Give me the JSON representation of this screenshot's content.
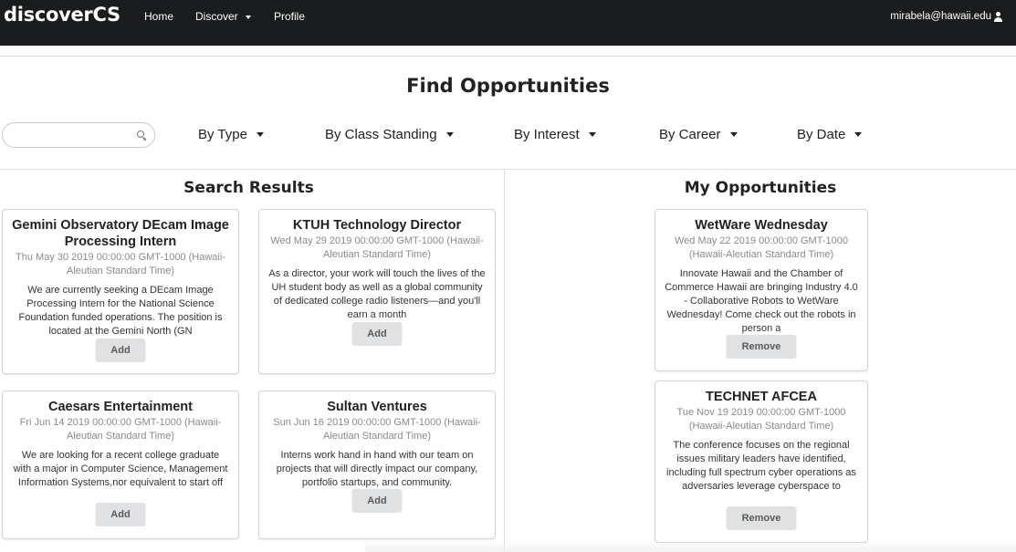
{
  "navbar": {
    "brand": "discoverCS",
    "home": "Home",
    "discover": "Discover",
    "profile": "Profile",
    "user_email": "mirabela@hawaii.edu"
  },
  "page_title": "Find Opportunities",
  "search": {
    "value": "",
    "placeholder": ""
  },
  "filters": {
    "type": "By Type",
    "class_standing": "By Class Standing",
    "interest": "By Interest",
    "career": "By Career",
    "date": "By Date"
  },
  "search_results": {
    "title": "Search Results",
    "cards": [
      {
        "title": "Gemini Observatory DEcam Image Processing Intern",
        "date": "Thu May 30 2019 00:00:00 GMT-1000 (Hawaii-Aleutian Standard Time)",
        "description": "We are currently seeking a DEcam Image Processing Intern for the National Science Foundation funded operations. The position is located at the Gemini North (GN",
        "button": "Add"
      },
      {
        "title": "KTUH Technology Director",
        "date": "Wed May 29 2019 00:00:00 GMT-1000 (Hawaii-Aleutian Standard Time)",
        "description": "As a director, your work will touch the lives of the UH student body as well as a global community of dedicated college radio listeners—and you'll earn a month",
        "button": "Add"
      },
      {
        "title": "Caesars Entertainment",
        "date": "Fri Jun 14 2019 00:00:00 GMT-1000 (Hawaii-Aleutian Standard Time)",
        "description": "We are looking for a recent college graduate with a major in Computer Science, Management Information Systems,nor equivalent to start off their career in IT as",
        "button": "Add"
      },
      {
        "title": "Sultan Ventures",
        "date": "Sun Jun 16 2019 00:00:00 GMT-1000 (Hawaii-Aleutian Standard Time)",
        "description": "Interns work hand in hand with our team on projects that will directly impact our company, portfolio startups, and community.",
        "button": "Add"
      }
    ]
  },
  "my_opportunities": {
    "title": "My Opportunities",
    "cards": [
      {
        "title": "WetWare Wednesday",
        "date": "Wed May 22 2019 00:00:00 GMT-1000 (Hawaii-Aleutian Standard Time)",
        "description": "Innovate Hawaii and the Chamber of Commerce Hawaii are bringing Industry 4.0 - Collaborative Robots to WetWare Wednesday! Come check out the robots in person a",
        "button": "Remove"
      },
      {
        "title": "TECHNET AFCEA",
        "date": "Tue Nov 19 2019 00:00:00 GMT-1000 (Hawaii-Aleutian Standard Time)",
        "description": "The conference focuses on the regional issues military leaders have identified, including full spectrum cyber operations as adversaries leverage cyberspace to",
        "button": "Remove"
      }
    ]
  }
}
